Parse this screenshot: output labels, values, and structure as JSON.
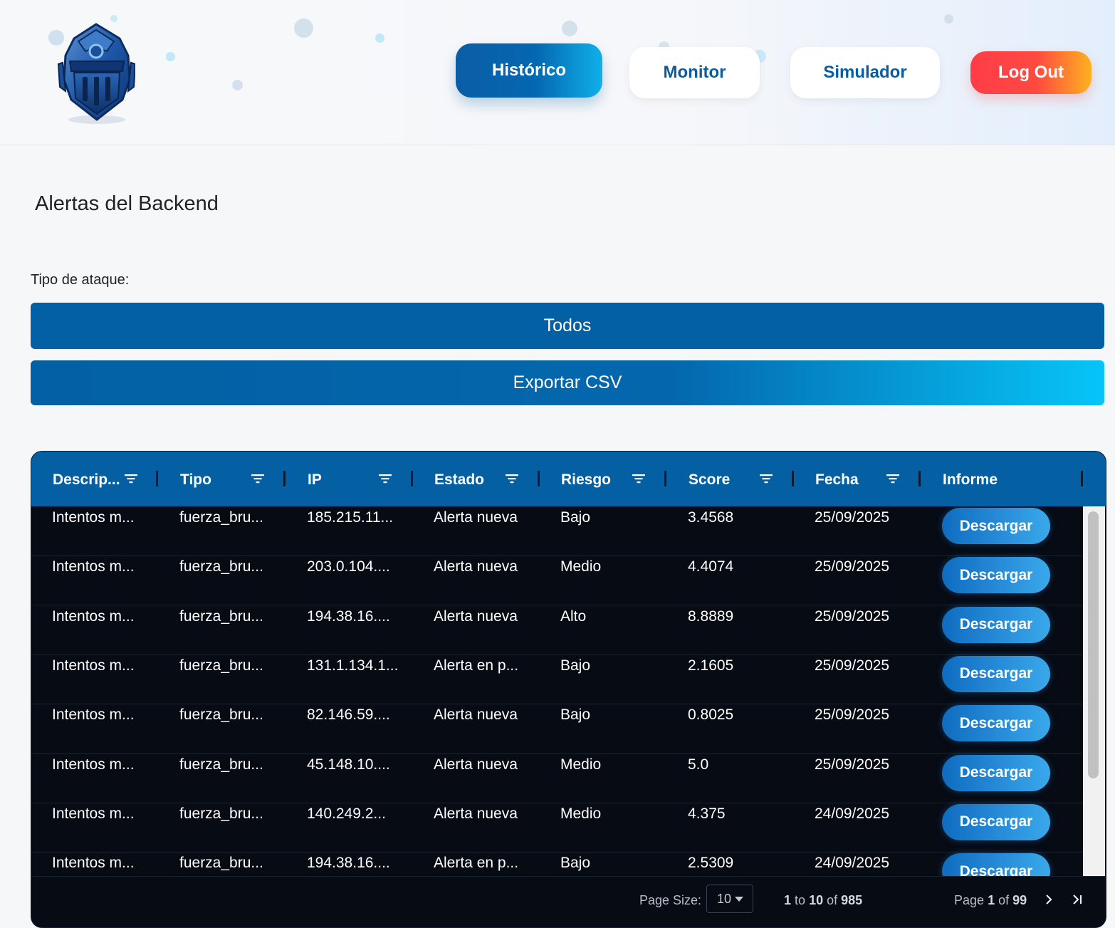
{
  "nav": {
    "historico": "Histórico",
    "monitor": "Monitor",
    "simulador": "Simulador",
    "logout": "Log Out"
  },
  "logo": {
    "icon": "knight-helmet-icon"
  },
  "colors": {
    "primary": "#0360a4",
    "accent": "#06c5f8",
    "logout_start": "#ff3c48",
    "logout_end": "#ffb21f",
    "grid_bg": "#060b14"
  },
  "page": {
    "title": "Alertas del Backend",
    "filter_label": "Tipo de ataque:",
    "filter_value": "Todos",
    "export_label": "Exportar CSV"
  },
  "grid": {
    "columns": [
      "Descrip...",
      "Tipo",
      "IP",
      "Estado",
      "Riesgo",
      "Score",
      "Fecha",
      "Informe"
    ],
    "download_label": "Descargar",
    "rows": [
      [
        "Intentos m...",
        "fuerza_bru...",
        "185.215.11...",
        "Alerta nueva",
        "Bajo",
        "3.4568",
        "25/09/2025"
      ],
      [
        "Intentos m...",
        "fuerza_bru...",
        "203.0.104....",
        "Alerta nueva",
        "Medio",
        "4.4074",
        "25/09/2025"
      ],
      [
        "Intentos m...",
        "fuerza_bru...",
        "194.38.16....",
        "Alerta nueva",
        "Alto",
        "8.8889",
        "25/09/2025"
      ],
      [
        "Intentos m...",
        "fuerza_bru...",
        "131.1.134.1...",
        "Alerta en p...",
        "Bajo",
        "2.1605",
        "25/09/2025"
      ],
      [
        "Intentos m...",
        "fuerza_bru...",
        "82.146.59....",
        "Alerta nueva",
        "Bajo",
        "0.8025",
        "25/09/2025"
      ],
      [
        "Intentos m...",
        "fuerza_bru...",
        "45.148.10....",
        "Alerta nueva",
        "Medio",
        "5.0",
        "25/09/2025"
      ],
      [
        "Intentos m...",
        "fuerza_bru...",
        "140.249.2...",
        "Alerta nueva",
        "Medio",
        "4.375",
        "24/09/2025"
      ],
      [
        "Intentos m...",
        "fuerza_bru...",
        "194.38.16....",
        "Alerta en p...",
        "Bajo",
        "2.5309",
        "24/09/2025"
      ]
    ]
  },
  "pagination": {
    "page_size_label": "Page Size:",
    "page_size": "10",
    "range_from": "1",
    "range_to_word": "to",
    "range_to": "10",
    "range_of_word": "of",
    "range_total": "985",
    "page_word": "Page",
    "page_current": "1",
    "page_of_word": "of",
    "page_total": "99"
  }
}
